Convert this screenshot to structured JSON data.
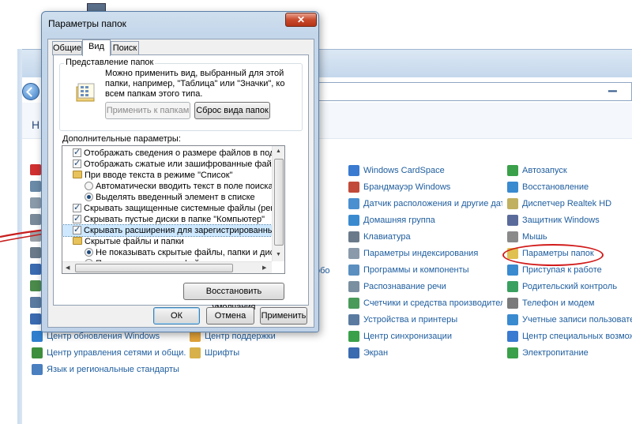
{
  "dialog": {
    "title": "Параметры папок",
    "close_glyph": "✕",
    "tabs": [
      {
        "label": "Общие"
      },
      {
        "label": "Вид"
      },
      {
        "label": "Поиск"
      }
    ],
    "folder_view": {
      "group_title": "Представление папок",
      "description": "Можно применить вид, выбранный для этой папки, например, \"Таблица\" или \"Значки\", ко всем папкам этого типа.",
      "apply_label": "Применить к папкам",
      "reset_label": "Сброс вида папок"
    },
    "advanced_label": "Дополнительные параметры:",
    "settings": [
      {
        "kind": "checkbox",
        "checked": true,
        "indent": 1,
        "text": "Отображать сведения о размере файлов в подсказк"
      },
      {
        "kind": "checkbox",
        "checked": true,
        "indent": 1,
        "text": "Отображать сжатые или зашифрованные файлы NTF"
      },
      {
        "kind": "folder",
        "indent": 1,
        "text": "При вводе текста в режиме \"Список\""
      },
      {
        "kind": "radio",
        "checked": false,
        "indent": 2,
        "text": "Автоматически вводить текст в поле поиска"
      },
      {
        "kind": "radio",
        "checked": true,
        "indent": 2,
        "text": "Выделять введенный элемент в списке"
      },
      {
        "kind": "checkbox",
        "checked": true,
        "indent": 1,
        "text": "Скрывать защищенные системные файлы (рекомен"
      },
      {
        "kind": "checkbox",
        "checked": true,
        "indent": 1,
        "text": "Скрывать пустые диски в папке \"Компьютер\""
      },
      {
        "kind": "checkbox",
        "checked": true,
        "indent": 1,
        "selected": true,
        "text": "Скрывать расширения для зарегистрированных типо"
      },
      {
        "kind": "folder",
        "indent": 1,
        "text": "Скрытые файлы и папки"
      },
      {
        "kind": "radio",
        "checked": true,
        "indent": 2,
        "text": "Не показывать скрытые файлы, папки и диски"
      },
      {
        "kind": "radio",
        "checked": false,
        "indent": 2,
        "text": "Показывать скрытые файлы, папки и диски"
      }
    ],
    "restore_label": "Восстановить умолчания",
    "ok_label": "ОК",
    "cancel_label": "Отмена",
    "apply_label": "Применить"
  },
  "control_panel": {
    "header_char": "Н",
    "visible_left_fragment": "обо",
    "items_col1": [
      {
        "label": "Центр обновления Windows",
        "color": "#2f7fce"
      },
      {
        "label": "Центр управления сетями и общи...",
        "color": "#3d8f3d"
      },
      {
        "label": "Язык и региональные стандарты",
        "color": "#4a7fc0"
      }
    ],
    "items_col2": [
      {
        "label": "Центр поддержки",
        "color": "#e2a33a"
      },
      {
        "label": "Шрифты",
        "color": "#d8b04a"
      }
    ],
    "items_col3": [
      {
        "label": "Windows CardSpace",
        "color": "#3a7ad0"
      },
      {
        "label": "Брандмауэр Windows",
        "color": "#c24a3a"
      },
      {
        "label": "Датчик расположения и другие дат...",
        "color": "#4a8fd0"
      },
      {
        "label": "Домашняя группа",
        "color": "#3a8ad0"
      },
      {
        "label": "Клавиатура",
        "color": "#6a7a8a"
      },
      {
        "label": "Параметры индексирования",
        "color": "#8a9aaa"
      },
      {
        "label": "Программы и компоненты",
        "color": "#5a8fc0"
      },
      {
        "label": "Распознавание речи",
        "color": "#7a8fa0"
      },
      {
        "label": "Счетчики и средства производител...",
        "color": "#4a9a5a"
      },
      {
        "label": "Устройства и принтеры",
        "color": "#5a7aa0"
      },
      {
        "label": "Центр синхронизации",
        "color": "#3aa04a"
      },
      {
        "label": "Экран",
        "color": "#3a6ab0"
      }
    ],
    "items_col4": [
      {
        "label": "Автозапуск",
        "color": "#3aa04a"
      },
      {
        "label": "Восстановление",
        "color": "#3a8ad0"
      },
      {
        "label": "Диспетчер Realtek HD",
        "color": "#c0b060"
      },
      {
        "label": "Защитник Windows",
        "color": "#5a6a9a"
      },
      {
        "label": "Мышь",
        "color": "#8a8a8a"
      },
      {
        "label": "Параметры папок",
        "color": "#e0c050"
      },
      {
        "label": "Приступая к работе",
        "color": "#3a8ad0"
      },
      {
        "label": "Родительский контроль",
        "color": "#3aa060"
      },
      {
        "label": "Телефон и модем",
        "color": "#7a7a7a"
      },
      {
        "label": "Учетные записи пользователе",
        "color": "#3a8ad0"
      },
      {
        "label": "Центр специальных возможн",
        "color": "#3a7ad0"
      },
      {
        "label": "Электропитание",
        "color": "#3aa04a"
      }
    ]
  }
}
